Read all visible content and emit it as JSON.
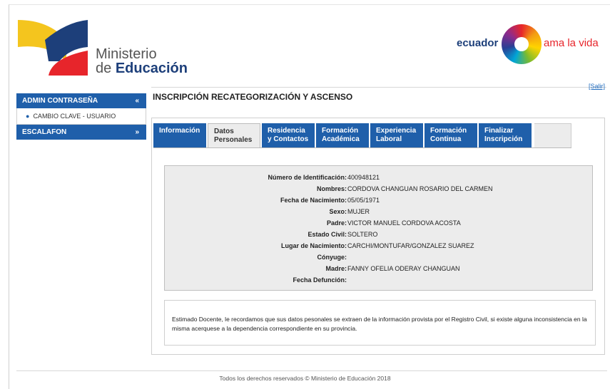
{
  "brand": {
    "ministry_line1": "Ministerio",
    "ministry_line2_prefix": "de ",
    "ministry_line2_bold": "Educación",
    "ecuador": "ecuador",
    "slogan": "ama la vida",
    "colors": {
      "yellow": "#f4c51e",
      "blue": "#1d3f7a",
      "red": "#e7252b"
    }
  },
  "header": {
    "salir": "[Salir]"
  },
  "sidebar": {
    "sections": [
      {
        "label": "ADMIN CONTRASEÑA",
        "arrow": "«"
      },
      {
        "label": "ESCALAFON",
        "arrow": "»"
      }
    ],
    "items": [
      {
        "label": "CAMBIO CLAVE - USUARIO"
      }
    ]
  },
  "main": {
    "title": "INSCRIPCIÓN RECATEGORIZACIÓN Y ASCENSO",
    "tabs": [
      {
        "line1": "Información",
        "line2": ""
      },
      {
        "line1": "Datos",
        "line2": "Personales"
      },
      {
        "line1": "Residencia",
        "line2": "y Contactos"
      },
      {
        "line1": "Formación",
        "line2": "Académica"
      },
      {
        "line1": "Experiencia",
        "line2": "Laboral"
      },
      {
        "line1": "Formación",
        "line2": "Continua"
      },
      {
        "line1": "Finalizar",
        "line2": "Inscripción"
      }
    ],
    "active_tab": "Datos Personales",
    "fields": [
      {
        "label": "Número de Identificación:",
        "value": "400948121"
      },
      {
        "label": "Nombres:",
        "value": "CORDOVA CHANGUAN ROSARIO DEL CARMEN"
      },
      {
        "label": "Fecha de Nacimiento:",
        "value": "05/05/1971"
      },
      {
        "label": "Sexo:",
        "value": "MUJER"
      },
      {
        "label": "Padre:",
        "value": "VICTOR MANUEL CORDOVA ACOSTA"
      },
      {
        "label": "Estado Civil:",
        "value": "SOLTERO"
      },
      {
        "label": "Lugar de Nacimiento:",
        "value": "CARCHI/MONTUFAR/GONZALEZ SUAREZ"
      },
      {
        "label": "Cónyuge:",
        "value": ""
      },
      {
        "label": "Madre:",
        "value": "FANNY OFELIA ODERAY CHANGUAN"
      },
      {
        "label": "Fecha Defunción:",
        "value": ""
      }
    ],
    "note": "Estimado Docente, le recordamos que sus datos pesonales se extraen de la información provista por el Registro Civil, si existe alguna inconsistencia en la misma acerquese a la dependencia correspondiente en su provincia."
  },
  "footer": {
    "text": "Todos los derechos reservados © Ministerio de Educación 2018"
  }
}
